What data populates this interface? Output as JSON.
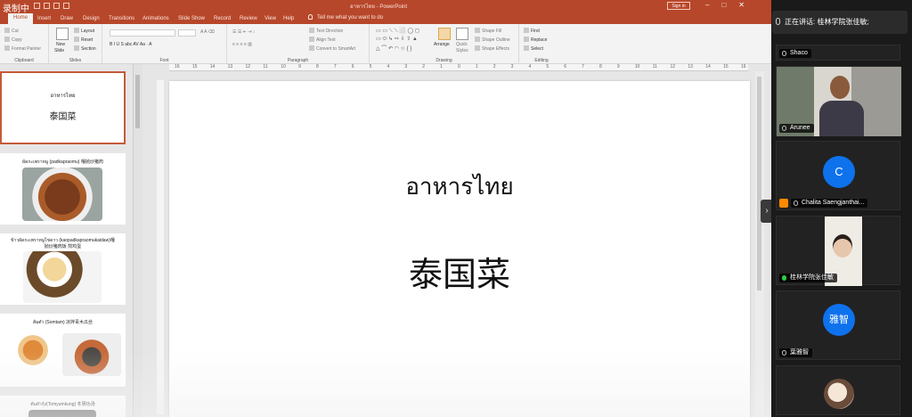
{
  "titlebar": {
    "recording_label": "录制中",
    "doc_title": "อาหารไทย  -  PowerPoint",
    "sign_in": "Sign in",
    "win_min": "–",
    "win_restore": "□",
    "win_close": "✕"
  },
  "tabs": [
    "Home",
    "Insert",
    "Draw",
    "Design",
    "Transitions",
    "Animations",
    "Slide Show",
    "Record",
    "Review",
    "View",
    "Help"
  ],
  "tell_me": "Tell me what you want to do",
  "ribbon": {
    "clipboard": {
      "cut": "Cut",
      "copy": "Copy",
      "format_painter": "Format Painter",
      "label": "Clipboard"
    },
    "slides": {
      "new_slide": "New",
      "new_slide2": "Slide",
      "layout": "Layout",
      "reset": "Reset",
      "section": "Section",
      "label": "Slides"
    },
    "font": {
      "label": "Font"
    },
    "paragraph": {
      "text_direction": "Text Direction",
      "align_text": "Align Text",
      "smartart": "Convert to SmartArt",
      "label": "Paragraph"
    },
    "drawing": {
      "arrange": "Arrange",
      "quick_styles": "Quick",
      "quick_styles2": "Styles",
      "shape_fill": "Shape Fill",
      "shape_outline": "Shape Outline",
      "shape_effects": "Shape Effects",
      "label": "Drawing"
    },
    "editing": {
      "find": "Find",
      "replace": "Replace",
      "select": "Select",
      "label": "Editing"
    }
  },
  "ruler_ticks": [
    "16",
    "15",
    "14",
    "13",
    "12",
    "11",
    "10",
    "9",
    "8",
    "7",
    "6",
    "5",
    "4",
    "3",
    "2",
    "1",
    "0",
    "1",
    "2",
    "3",
    "4",
    "5",
    "6",
    "7",
    "8",
    "9",
    "10",
    "11",
    "12",
    "13",
    "14",
    "15",
    "16"
  ],
  "thumbnails": [
    {
      "title_th": "อาหารไทย",
      "title_zh": "泰国菜"
    },
    {
      "caption": "ผัดกะเพราหมู (padkapraomu) 嘎抛炒猪肉"
    },
    {
      "caption": "ข้าวผัดกะเพราหมูไข่ดาว (kaopadkapraomukaidaw)嘎",
      "caption2": "抛炒猪肉饭 煎鸡蛋"
    },
    {
      "caption": "ส้มตำ (Somtam) 凉拌青木瓜丝"
    },
    {
      "caption": "ต้มยำกุ้ง(Tomyumkung) 冬阴功汤"
    }
  ],
  "slide": {
    "title_th": "อาหารไทย",
    "title_zh": "泰国菜"
  },
  "gallery": {
    "speaking": "正在讲话: 桂林学院张佳敏;",
    "tiles": [
      {
        "name": "Shaco"
      },
      {
        "name": "Arunee"
      },
      {
        "name": "Chalita Saengjanthai...",
        "initial": "C"
      },
      {
        "name": "桂林学院张佳敏"
      },
      {
        "name": "葉雅智",
        "initial": "雅智"
      },
      {
        "name": ""
      }
    ],
    "collapse_glyph": "›"
  },
  "colors": {
    "ppt_accent": "#b7472a",
    "zoom_blue": "#0e72ed",
    "speaking_green": "#2ecc40"
  }
}
